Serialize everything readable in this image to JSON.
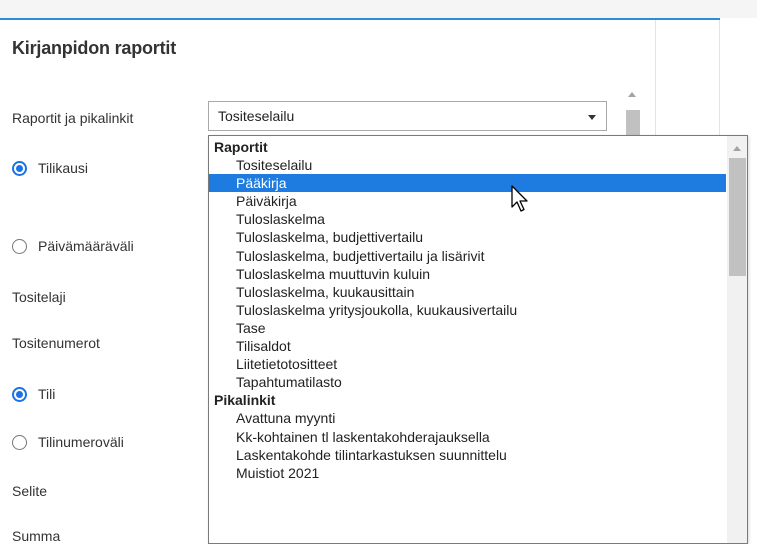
{
  "page": {
    "title": "Kirjanpidon raportit"
  },
  "form": {
    "report_label": "Raportit ja pikalinkit",
    "selected_report": "Tositeselailu",
    "radio_tilikausi": "Tilikausi",
    "radio_paivamaaravali": "Päivämääräväli",
    "tositelaji_label": "Tositelaji",
    "tositenumerot_label": "Tositenumerot",
    "radio_tili": "Tili",
    "radio_tilinumerovali": "Tilinumeroväli",
    "selite_label": "Selite",
    "summa_label": "Summa"
  },
  "radios": {
    "tilikausi_checked": true,
    "paivamaaravali_checked": false,
    "tili_checked": true,
    "tilinumerovali_checked": false
  },
  "dropdown": {
    "groups": [
      {
        "label": "Raportit",
        "items": [
          "Tositeselailu",
          "Pääkirja",
          "Päiväkirja",
          "Tuloslaskelma",
          "Tuloslaskelma, budjettivertailu",
          "Tuloslaskelma, budjettivertailu ja lisärivit",
          "Tuloslaskelma muuttuvin kuluin",
          "Tuloslaskelma, kuukausittain",
          "Tuloslaskelma yritysjoukolla, kuukausivertailu",
          "Tase",
          "Tilisaldot",
          "Liitetietotositteet",
          "Tapahtumatilasto"
        ]
      },
      {
        "label": "Pikalinkit",
        "items": [
          "Avattuna myynti",
          "Kk-kohtainen tl laskentakohderajauksella",
          "Laskentakohde tilintarkastuksen suunnittelu",
          "Muistiot 2021"
        ]
      }
    ],
    "highlighted": "Pääkirja"
  },
  "colors": {
    "accent": "#2a8fd6",
    "selection": "#1e7be0",
    "radio": "#1a73e8"
  },
  "icons": {
    "caret": "chevron-down-icon",
    "cursor": "mouse-pointer-icon"
  }
}
